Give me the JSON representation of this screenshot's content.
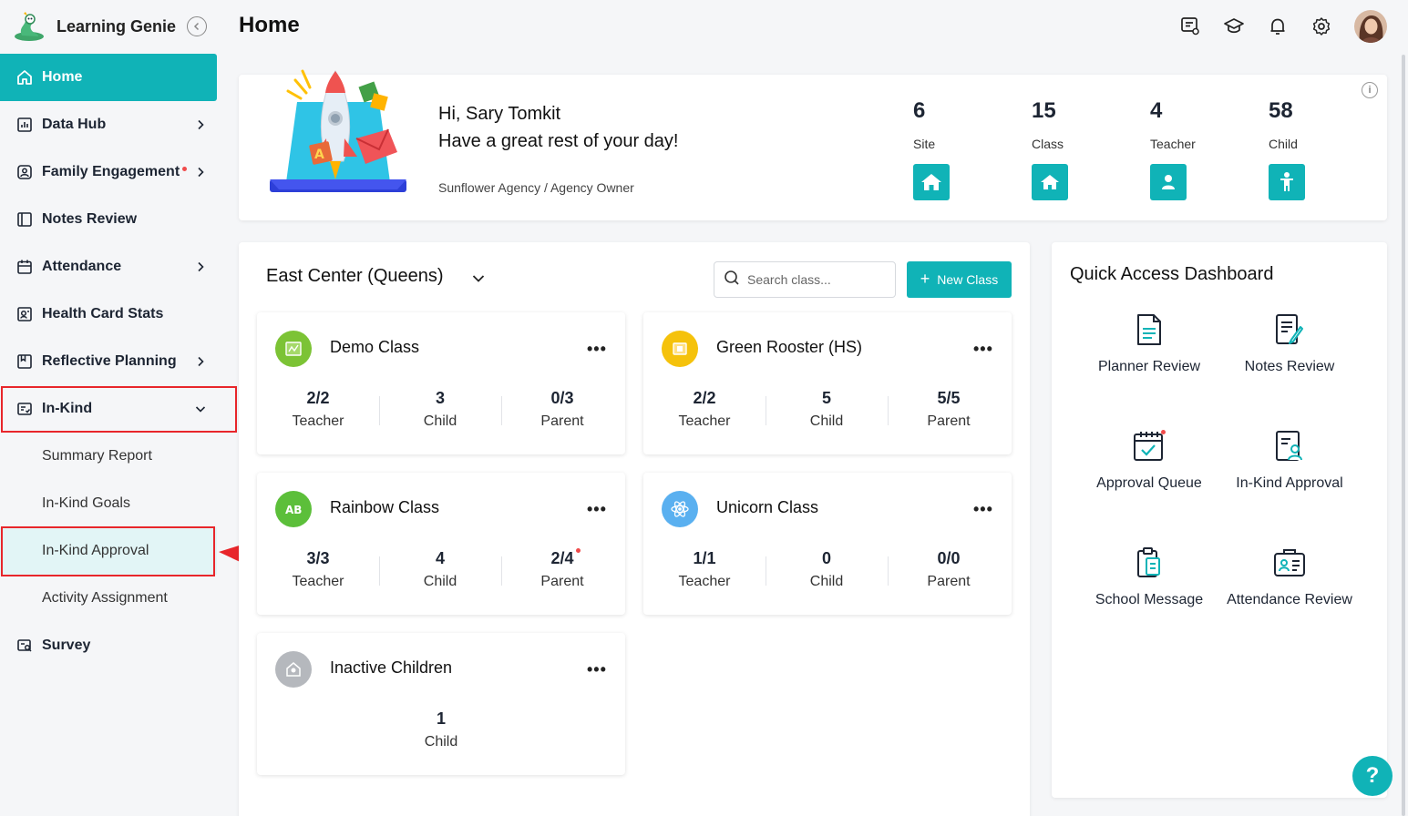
{
  "brand": {
    "name": "Learning Genie"
  },
  "header": {
    "title": "Home"
  },
  "sidebar": {
    "items": [
      {
        "label": "Home"
      },
      {
        "label": "Data Hub"
      },
      {
        "label": "Family Engagement"
      },
      {
        "label": "Notes Review"
      },
      {
        "label": "Attendance"
      },
      {
        "label": "Health Card Stats"
      },
      {
        "label": "Reflective Planning"
      },
      {
        "label": "In-Kind"
      },
      {
        "label": "Survey"
      }
    ],
    "inkind_sub": [
      {
        "label": "Summary Report"
      },
      {
        "label": "In-Kind Goals"
      },
      {
        "label": "In-Kind Approval"
      },
      {
        "label": "Activity Assignment"
      }
    ]
  },
  "welcome": {
    "greeting": "Hi, Sary Tomkit",
    "message": "Have a great rest of your day!",
    "org": "Sunflower Agency / Agency Owner",
    "stats": [
      {
        "value": "6",
        "label": "Site",
        "icon": "home-icon"
      },
      {
        "value": "15",
        "label": "Class",
        "icon": "house-icon"
      },
      {
        "value": "4",
        "label": "Teacher",
        "icon": "person-icon"
      },
      {
        "value": "58",
        "label": "Child",
        "icon": "child-icon"
      }
    ]
  },
  "classes_panel": {
    "center": "East Center (Queens)",
    "search_placeholder": "Search class...",
    "new_class_label": "New Class",
    "classes": [
      {
        "name": "Demo Class",
        "stats": [
          {
            "value": "2/2",
            "label": "Teacher"
          },
          {
            "value": "3",
            "label": "Child"
          },
          {
            "value": "0/3",
            "label": "Parent"
          }
        ]
      },
      {
        "name": "Green Rooster (HS)",
        "stats": [
          {
            "value": "2/2",
            "label": "Teacher"
          },
          {
            "value": "5",
            "label": "Child"
          },
          {
            "value": "5/5",
            "label": "Parent"
          }
        ]
      },
      {
        "name": "Rainbow Class",
        "stats": [
          {
            "value": "3/3",
            "label": "Teacher"
          },
          {
            "value": "4",
            "label": "Child"
          },
          {
            "value": "2/4",
            "label": "Parent"
          }
        ]
      },
      {
        "name": "Unicorn Class",
        "stats": [
          {
            "value": "1/1",
            "label": "Teacher"
          },
          {
            "value": "0",
            "label": "Child"
          },
          {
            "value": "0/0",
            "label": "Parent"
          }
        ]
      },
      {
        "name": "Inactive Children",
        "stats": [
          {
            "value": "1",
            "label": "Child"
          }
        ]
      }
    ]
  },
  "quick_access": {
    "title": "Quick Access Dashboard",
    "items": [
      {
        "label": "Planner Review"
      },
      {
        "label": "Notes Review"
      },
      {
        "label": "Approval Queue"
      },
      {
        "label": "In-Kind Approval"
      },
      {
        "label": "School Message"
      },
      {
        "label": "Attendance Review"
      }
    ]
  },
  "help": {
    "label": "?"
  },
  "colors": {
    "accent": "#10b3b7",
    "highlight": "#e8262b",
    "selected_bg": "#e2f5f6"
  }
}
